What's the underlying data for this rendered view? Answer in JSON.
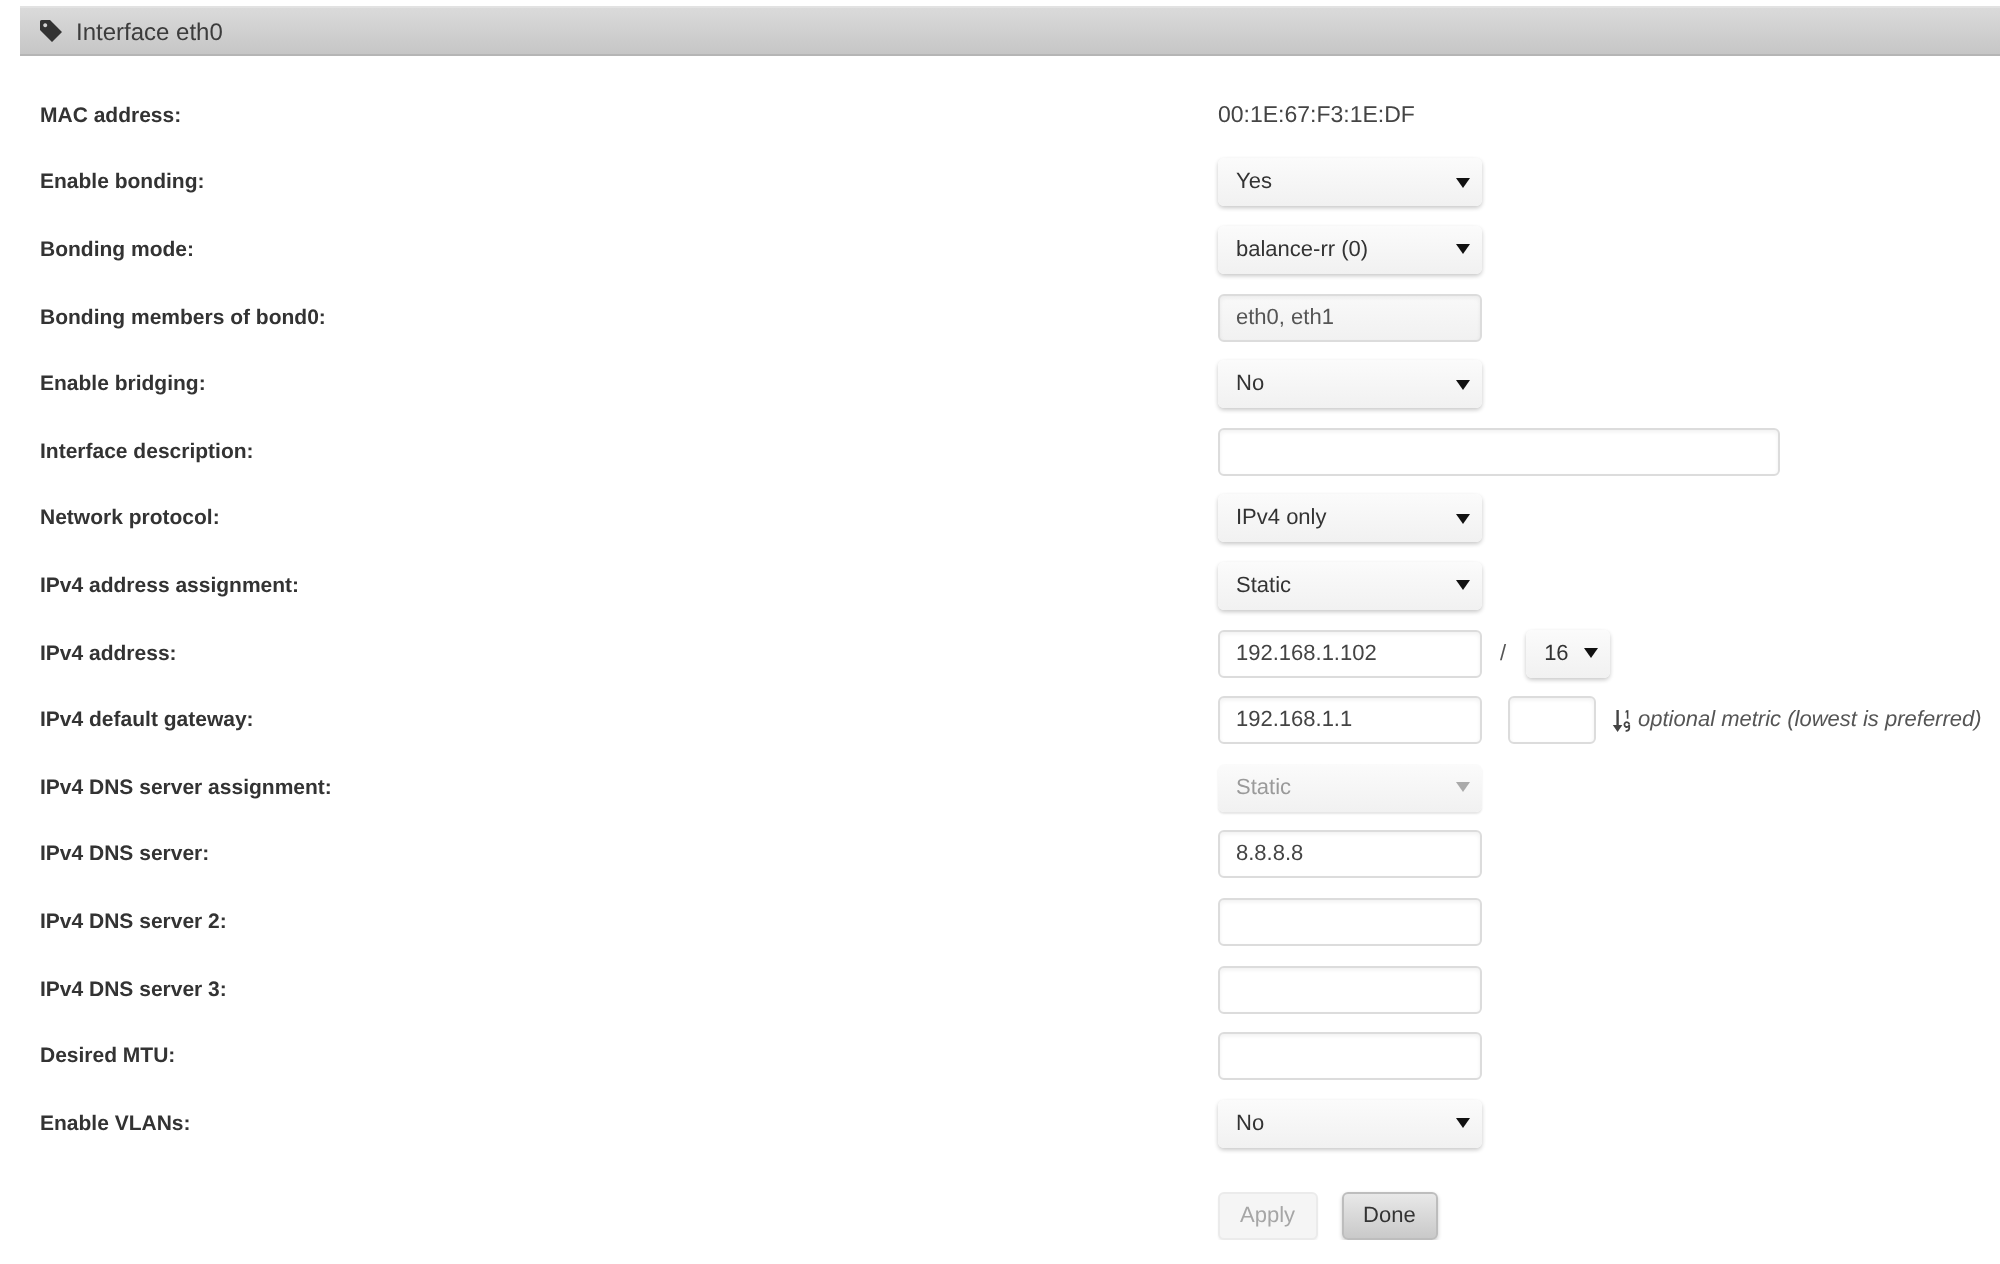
{
  "panel": {
    "title": "Interface eth0"
  },
  "fields": [
    {
      "label": "MAC address:",
      "kind": "text",
      "value": "00:1E:67:F3:1E:DF",
      "disabled": false
    },
    {
      "label": "Enable bonding:",
      "kind": "select",
      "value": "Yes",
      "disabled": false
    },
    {
      "label": "Bonding mode:",
      "kind": "select",
      "value": "balance-rr (0)",
      "disabled": false
    },
    {
      "label": "Bonding members of bond0:",
      "kind": "readonly",
      "value": "eth0, eth1",
      "disabled": false
    },
    {
      "label": "Enable bridging:",
      "kind": "select",
      "value": "No",
      "disabled": false
    },
    {
      "label": "Interface description:",
      "kind": "long-input",
      "disabled": false
    },
    {
      "label": "Network protocol:",
      "kind": "select",
      "value": "IPv4 only",
      "disabled": false
    },
    {
      "label": "IPv4 address assignment:",
      "kind": "select",
      "value": "Static",
      "disabled": false
    },
    {
      "label": "IPv4 address:",
      "kind": "address",
      "value": "192.168.1.102",
      "separator": "/",
      "prefix": "16",
      "disabled": false
    },
    {
      "label": "IPv4 default gateway:",
      "kind": "gateway",
      "value": "192.168.1.1",
      "note": "optional metric (lowest is preferred)",
      "disabled": false
    },
    {
      "label": "IPv4 DNS server assignment:",
      "kind": "select",
      "value": "Static",
      "disabled": true
    },
    {
      "label": "IPv4 DNS server:",
      "kind": "input",
      "value": "8.8.8.8",
      "disabled": false
    },
    {
      "label": "IPv4 DNS server 2:",
      "kind": "input",
      "disabled": false
    },
    {
      "label": "IPv4 DNS server 3:",
      "kind": "input",
      "disabled": false
    },
    {
      "label": "Desired MTU:",
      "kind": "input",
      "disabled": false
    },
    {
      "label": "Enable VLANs:",
      "kind": "select",
      "value": "No",
      "disabled": false
    }
  ],
  "buttons": [
    {
      "label": "Apply",
      "disabled": true
    },
    {
      "label": "Done",
      "disabled": false
    }
  ]
}
